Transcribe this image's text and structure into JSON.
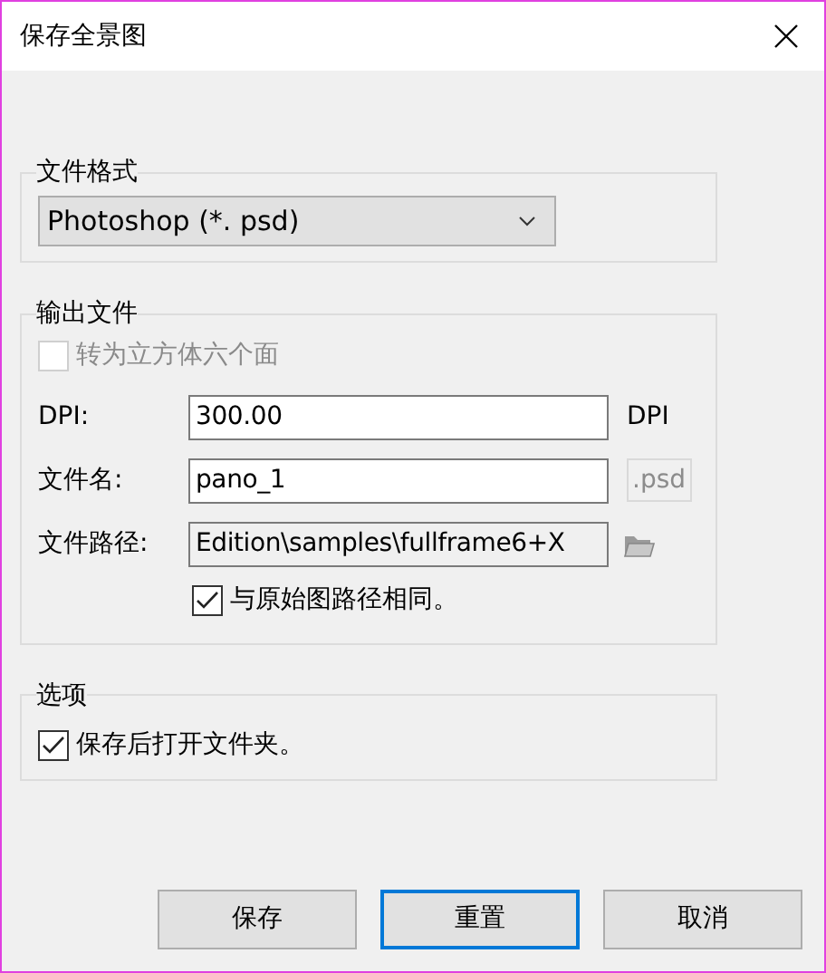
{
  "window": {
    "title": "保存全景图"
  },
  "format_group": {
    "legend": "文件格式",
    "select": {
      "value": "Photoshop (*. psd)"
    }
  },
  "output_group": {
    "legend": "输出文件",
    "cube_checkbox": {
      "label": "转为立方体六个面",
      "checked": false,
      "disabled": true
    },
    "dpi": {
      "label": "DPI:",
      "value": "300.00",
      "unit": "DPI"
    },
    "filename": {
      "label": "文件名:",
      "value": "pano_1",
      "extension": ".psd"
    },
    "path": {
      "label": "文件路径:",
      "value": "Edition\\samples\\fullframe6+X"
    },
    "same_path_checkbox": {
      "label": "与原始图路径相同。",
      "checked": true,
      "disabled": false
    }
  },
  "options_group": {
    "legend": "选项",
    "open_folder_checkbox": {
      "label": "保存后打开文件夹。",
      "checked": true,
      "disabled": false
    }
  },
  "buttons": [
    {
      "label": "保存",
      "focused": false
    },
    {
      "label": "重置",
      "focused": true
    },
    {
      "label": "取消",
      "focused": false
    }
  ]
}
